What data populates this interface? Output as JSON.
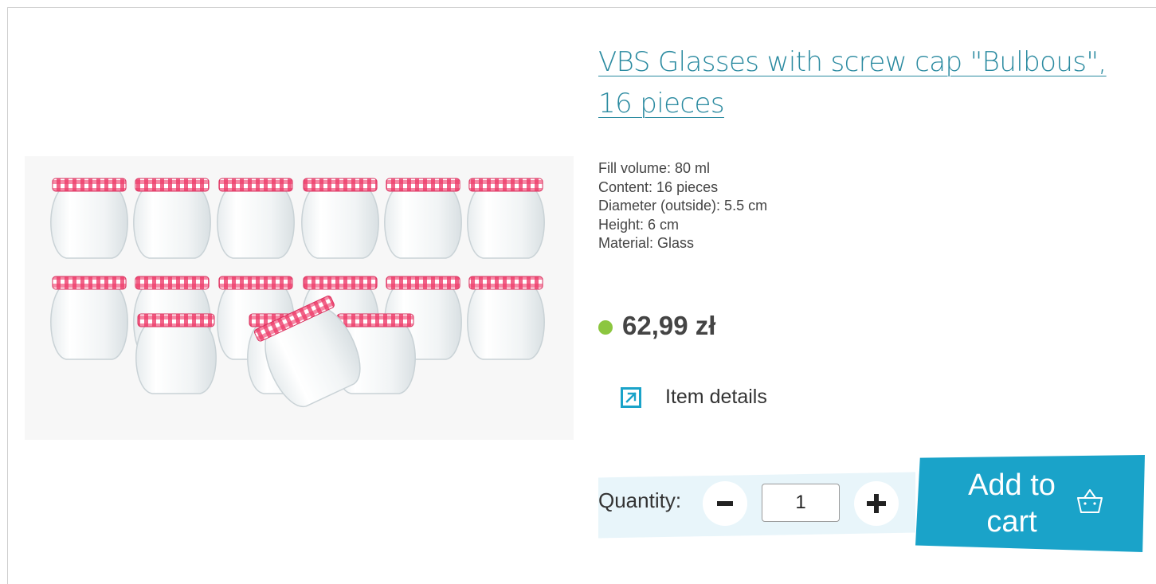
{
  "product": {
    "title": "VBS Glasses with screw cap \"Bulbous\", 16 pieces",
    "specs": [
      "Fill volume: 80 ml",
      "Content: 16 pieces",
      "Diameter (outside): 5.5 cm",
      "Height: 6 cm",
      "Material: Glass"
    ],
    "price": "62,99 zł",
    "availability_color": "#8cc63f",
    "details_label": "Item details",
    "details_icon": "arrow-up-right-icon"
  },
  "cart": {
    "quantity_label": "Quantity:",
    "quantity_value": "1",
    "minus_icon": "minus-icon",
    "plus_icon": "plus-icon",
    "add_label": "Add to cart",
    "cart_icon": "shopping-basket-icon"
  },
  "colors": {
    "accent": "#1aa3c9",
    "title": "#2a8aa0",
    "text": "#444444",
    "quantity_bg": "#e8f5fa"
  }
}
